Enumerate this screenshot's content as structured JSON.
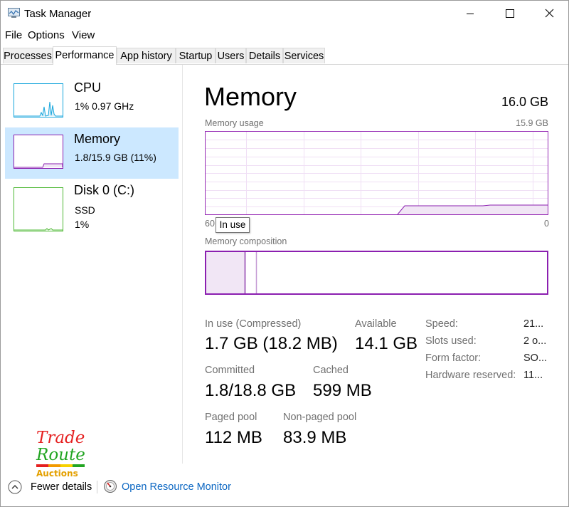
{
  "window": {
    "title": "Task Manager"
  },
  "menu": [
    "File",
    "Options",
    "View"
  ],
  "tabs": [
    "Processes",
    "Performance",
    "App history",
    "Startup",
    "Users",
    "Details",
    "Services"
  ],
  "active_tab": "Performance",
  "sidebar": {
    "items": [
      {
        "name": "CPU",
        "sub1": "1%  0.97 GHz",
        "sub2": "",
        "color": "#17a6dc"
      },
      {
        "name": "Memory",
        "sub1": "1.8/15.9 GB (11%)",
        "sub2": "",
        "color": "#8b1fb0",
        "selected": true
      },
      {
        "name": "Disk 0 (C:)",
        "sub1": "SSD",
        "sub2": "1%",
        "color": "#4db833"
      }
    ]
  },
  "main": {
    "title": "Memory",
    "total": "16.0 GB",
    "usage_label": "Memory usage",
    "usage_max": "15.9 GB",
    "axis_left": "60",
    "axis_right": "0",
    "tooltip": "In use",
    "composition_label": "Memory composition"
  },
  "stats": {
    "in_use_label": "In use (Compressed)",
    "in_use_value": "1.7 GB (18.2 MB)",
    "available_label": "Available",
    "available_value": "14.1 GB",
    "committed_label": "Committed",
    "committed_value": "1.8/18.8 GB",
    "cached_label": "Cached",
    "cached_value": "599 MB",
    "paged_label": "Paged pool",
    "paged_value": "112 MB",
    "nonpaged_label": "Non-paged pool",
    "nonpaged_value": "83.9 MB"
  },
  "specs": [
    {
      "label": "Speed:",
      "value": "21..."
    },
    {
      "label": "Slots used:",
      "value": "2 o..."
    },
    {
      "label": "Form factor:",
      "value": "SO..."
    },
    {
      "label": "Hardware reserved:",
      "value": "11..."
    }
  ],
  "footer": {
    "fewer_details": "Fewer details",
    "open_resource_monitor": "Open Resource Monitor"
  },
  "watermark": {
    "line1": "Trade",
    "line2": "Route",
    "line3": "Auctions"
  },
  "colors": {
    "memory_accent": "#8b1fb0",
    "selected_bg": "#cce8ff",
    "link": "#0a66c2",
    "cpu": "#17a6dc",
    "disk": "#4db833"
  }
}
